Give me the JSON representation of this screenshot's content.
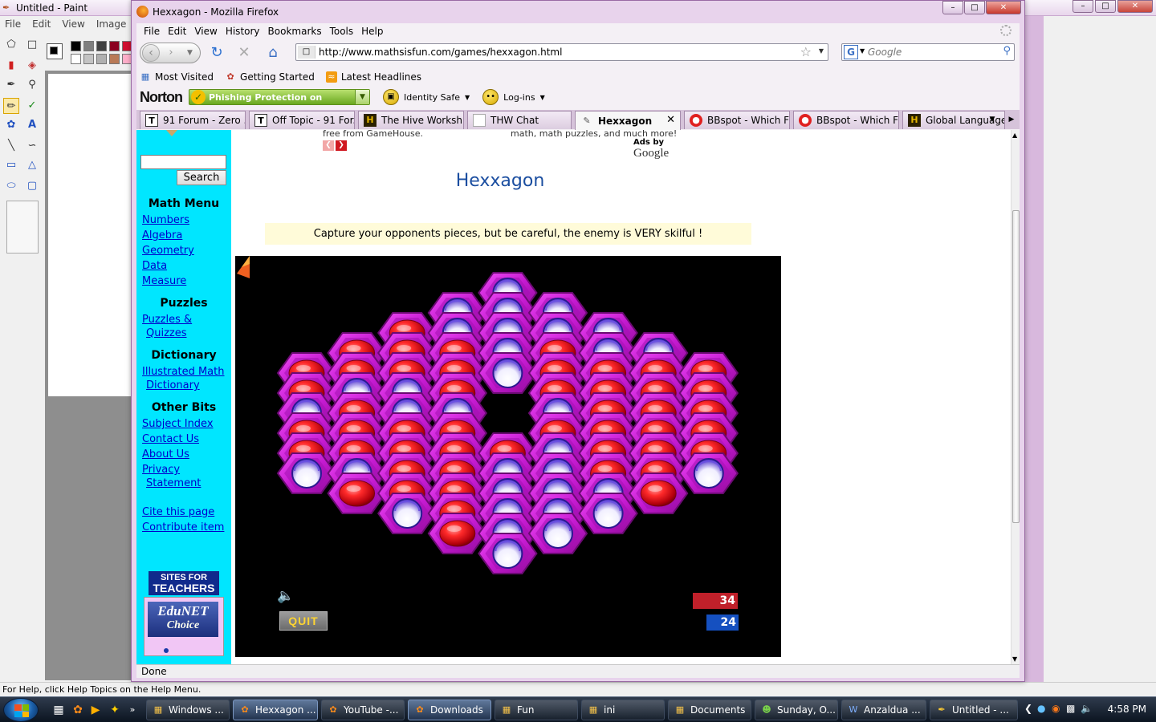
{
  "paint": {
    "title": "Untitled - Paint",
    "menu": [
      "File",
      "Edit",
      "View",
      "Image"
    ],
    "status": "For Help, click Help Topics on the Help Menu."
  },
  "firefox": {
    "title": "Hexxagon - Mozilla Firefox",
    "menu": [
      "File",
      "Edit",
      "View",
      "History",
      "Bookmarks",
      "Tools",
      "Help"
    ],
    "url": "http://www.mathsisfun.com/games/hexxagon.html",
    "search_placeholder": "Google",
    "bookmarks": [
      {
        "label": "Most Visited",
        "icon": "bookmarks-icon"
      },
      {
        "label": "Getting Started",
        "icon": "firefox-icon"
      },
      {
        "label": "Latest Headlines",
        "icon": "rss-icon"
      }
    ],
    "norton": {
      "logo": "Norton",
      "phishing": "Phishing Protection on",
      "identity_safe": "Identity Safe",
      "logins": "Log-ins"
    },
    "tabs": [
      {
        "label": "91 Forum - Zero ...",
        "icon": "T"
      },
      {
        "label": "Off Topic - 91 For...",
        "icon": "T"
      },
      {
        "label": "The Hive Worksh...",
        "icon": "H"
      },
      {
        "label": "THW Chat",
        "icon": "page"
      },
      {
        "label": "Hexxagon",
        "icon": "hexx",
        "active": true
      },
      {
        "label": "BBspot - Which Fi...",
        "icon": "bb"
      },
      {
        "label": "BBspot - Which Fi...",
        "icon": "bb"
      },
      {
        "label": "Global Language:...",
        "icon": "H"
      }
    ],
    "status": "Done"
  },
  "page": {
    "ad_left": "free from GameHouse.",
    "ad_right": "math, math puzzles, and much more!",
    "ads_by": "Ads by",
    "google": "Google",
    "title": "Hexxagon",
    "subtitle": "Capture your opponents pieces, but be careful, the enemy is VERY skilful !",
    "sidebar": {
      "search_button": "Search",
      "sections": [
        {
          "heading": "Math Menu",
          "links": [
            "Numbers",
            "Algebra",
            "Geometry",
            "Data",
            "Measure"
          ]
        },
        {
          "heading": "Puzzles",
          "links": [
            "Puzzles &",
            "Quizzes"
          ]
        },
        {
          "heading": "Dictionary",
          "links": [
            "Illustrated Math",
            "Dictionary"
          ]
        },
        {
          "heading": "Other Bits",
          "links": [
            "Subject Index",
            "Contact Us",
            "About Us",
            "Privacy",
            "Statement"
          ]
        }
      ],
      "extra_links": [
        "Cite this page",
        "Contribute item"
      ],
      "badge_top": "SITES FOR",
      "badge_bottom": "TEACHERS",
      "edunet_top": "EduNET",
      "edunet_bottom": "Choice"
    },
    "game": {
      "quit": "QUIT",
      "score_red": "34",
      "score_blue": "24",
      "colors": {
        "board": "#cc1fd6",
        "red": "#e0101c",
        "white": "#ffffff"
      },
      "board": [
        "....W....",
        "...WWW...",
        "..RWWWW..",
        ".RRRWRWW.",
        "RRRRWRRRR",
        "RWWR.RRRR",
        "WRWW.WRRR",
        "RRRR.RRRR",
        "RRRRRWRRR",
        "WWRRWWRRW",
        ".RRRWWWR.",
        "..WRWWW..",
        "...RWW...",
        "....W...."
      ]
    }
  },
  "taskbar": {
    "items": [
      {
        "label": "Windows ...",
        "icon": "folder"
      },
      {
        "label": "Hexxagon ...",
        "icon": "firefox",
        "active": true
      },
      {
        "label": "YouTube -...",
        "icon": "firefox"
      },
      {
        "label": "Downloads",
        "icon": "firefox",
        "active": true
      },
      {
        "label": "Fun",
        "icon": "folder"
      },
      {
        "label": "ini",
        "icon": "folder"
      },
      {
        "label": "Documents",
        "icon": "folder"
      },
      {
        "label": "Sunday, O...",
        "icon": "msn"
      },
      {
        "label": "Anzaldua ...",
        "icon": "word"
      },
      {
        "label": "Untitled - ...",
        "icon": "paint"
      }
    ],
    "clock": "4:58 PM"
  }
}
